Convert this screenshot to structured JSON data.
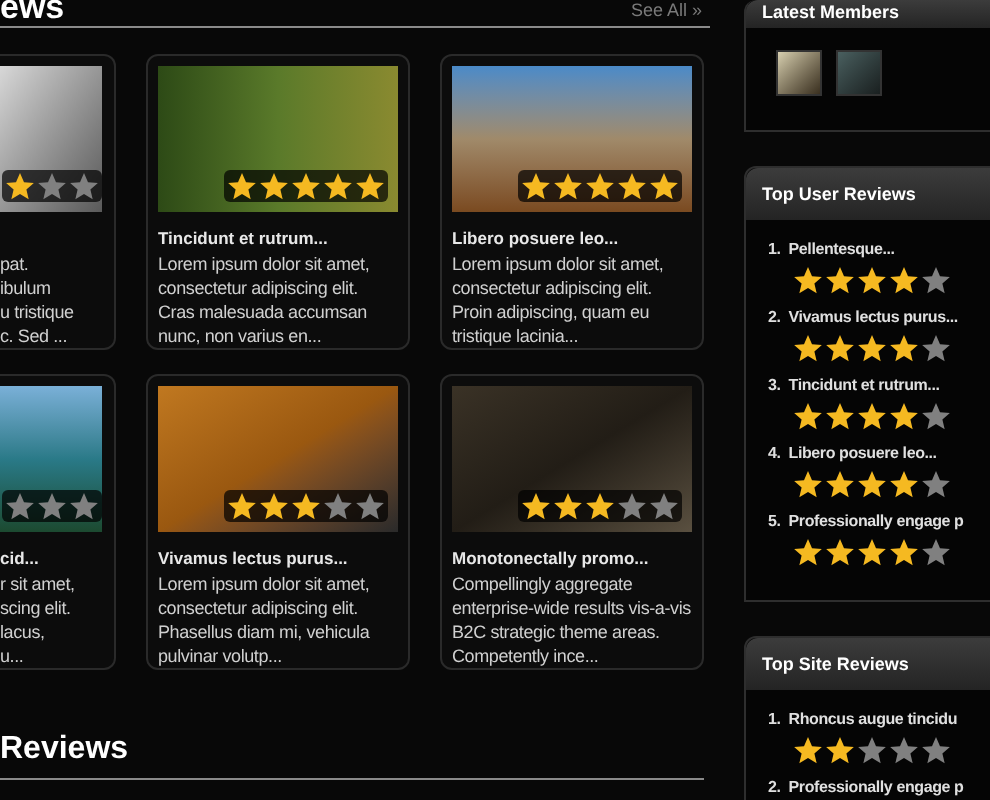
{
  "main": {
    "heading": "ews",
    "see_all": "See All »",
    "card_rows": [
      [
        {
          "lines": [
            "pat.",
            "ibulum",
            "u tristique",
            "c. Sed ..."
          ],
          "stars": 1
        },
        {
          "title": "Tincidunt et rutrum...",
          "lines": [
            "Lorem ipsum dolor sit amet,",
            "consectetur adipiscing elit.",
            "Cras malesuada accumsan",
            "nunc, non varius en..."
          ],
          "stars": 5
        },
        {
          "title": "Libero posuere leo...",
          "lines": [
            "Lorem ipsum dolor sit amet,",
            "consectetur adipiscing elit.",
            "Proin adipiscing, quam eu",
            "tristique lacinia..."
          ],
          "stars": 5
        }
      ],
      [
        {
          "title": "cid...",
          "lines": [
            "r sit amet,",
            "scing elit.",
            "lacus,",
            "u..."
          ]
        },
        {
          "title": "Vivamus lectus purus...",
          "lines": [
            "Lorem ipsum dolor sit amet,",
            "consectetur adipiscing elit.",
            "Phasellus diam mi, vehicula",
            "pulvinar volutp..."
          ],
          "stars": 3
        },
        {
          "title": "Monotonectally promo...",
          "lines": [
            "Compellingly aggregate",
            "enterprise-wide results vis-a-vis",
            "B2C strategic theme areas.",
            "Competently ince..."
          ],
          "stars": 3
        }
      ]
    ],
    "second_heading": "Reviews"
  },
  "sidebar": {
    "latest_members": {
      "title": "Latest Members"
    },
    "top_user_reviews": {
      "title": "Top User Reviews",
      "items": [
        {
          "number": "1.",
          "title": "Pellentesque...",
          "stars": 4
        },
        {
          "number": "2.",
          "title": "Vivamus lectus purus...",
          "stars": 4
        },
        {
          "number": "3.",
          "title": "Tincidunt et rutrum...",
          "stars": 4
        },
        {
          "number": "4.",
          "title": "Libero posuere leo...",
          "stars": 4
        },
        {
          "number": "5.",
          "title": "Professionally engage p",
          "stars": 4
        }
      ]
    },
    "top_site_reviews": {
      "title": "Top Site Reviews",
      "items": [
        {
          "number": "1.",
          "title": "Rhoncus augue tincidu",
          "stars": 2
        },
        {
          "number": "2.",
          "title": "Professionally engage p"
        }
      ]
    }
  }
}
